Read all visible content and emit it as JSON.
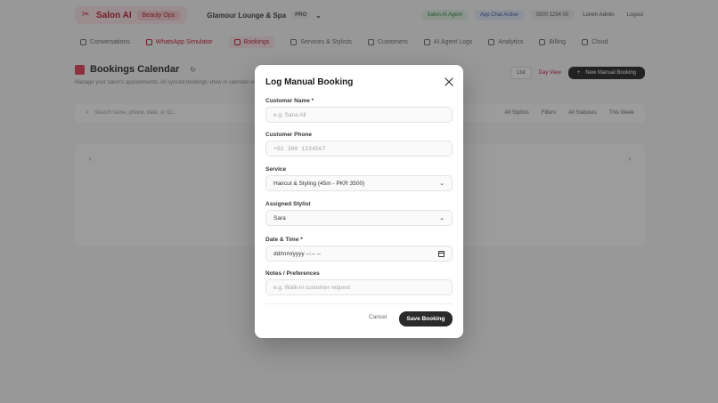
{
  "app": {
    "brand_name": "Salon AI",
    "brand_tag": "Beauty Ops",
    "salon_name": "Glamour Lounge & Spa",
    "salon_badge": "PRO",
    "status_pills": [
      "Salon AI Agent",
      "App Chat Active",
      "0300 1234 00"
    ],
    "user_label": "Lorem Admin",
    "logout_label": "Logout"
  },
  "nav": {
    "items": [
      "Conversations",
      "WhatsApp Simulator",
      "Bookings",
      "Services & Stylists",
      "Customers",
      "AI Agent Logs",
      "Analytics",
      "Billing",
      "Cloud"
    ]
  },
  "page": {
    "title": "Bookings Calendar",
    "subtitle": "Manage your salon's appointments. All synced bookings show in calendar view.",
    "list_label": "List",
    "day_label": "Day View",
    "new_booking_label": "New Manual Booking",
    "search_placeholder": "Search name, phone, date, or ID...",
    "filter_labels": [
      "All Stylists",
      "Filters",
      "All Statuses",
      "This Week"
    ],
    "cal_prev": "‹",
    "cal_next": "›"
  },
  "modal": {
    "title": "Log Manual Booking",
    "customer_name": {
      "label": "Customer Name *",
      "placeholder": "e.g. Sana Ali",
      "value": ""
    },
    "customer_phone": {
      "label": "Customer Phone",
      "placeholder": "+92 300 1234567",
      "value": ""
    },
    "service": {
      "label": "Service",
      "value": "Haircut & Styling (45m - PKR 3500)"
    },
    "stylist": {
      "label": "Assigned Stylist",
      "value": "Sara"
    },
    "datetime": {
      "label": "Date & Time *",
      "placeholder": "dd/mm/yyyy --:-- --"
    },
    "notes": {
      "label": "Notes / Preferences",
      "placeholder": "e.g. Walk-in customer request",
      "value": ""
    },
    "cancel_label": "Cancel",
    "save_label": "Save Booking"
  },
  "icons": {
    "close": "close-icon",
    "dropdown": "chevron-down-icon",
    "calendar": "calendar-icon"
  },
  "colors": {
    "brand": "#c8102e",
    "overlay": "rgba(40,40,40,0.46)",
    "primary_button": "#2a2a2a"
  }
}
